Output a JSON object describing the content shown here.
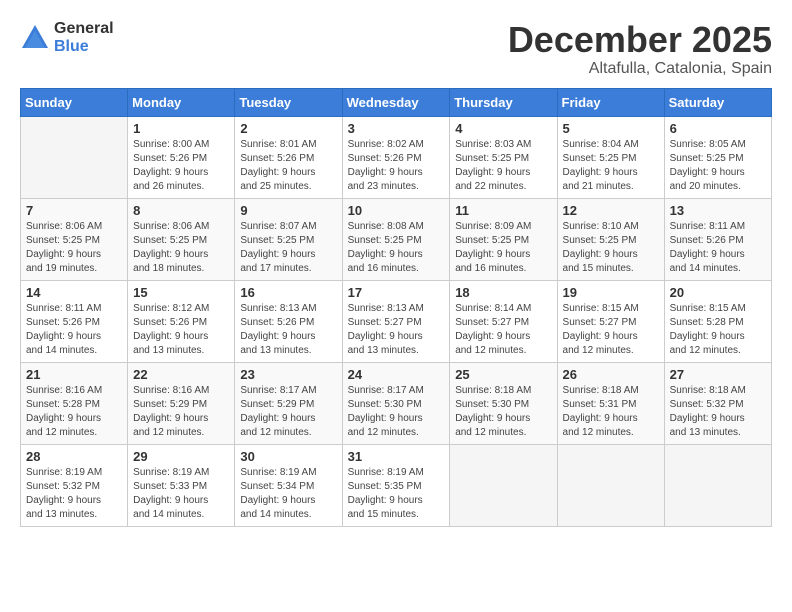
{
  "logo": {
    "general": "General",
    "blue": "Blue"
  },
  "title": {
    "month": "December 2025",
    "location": "Altafulla, Catalonia, Spain"
  },
  "headers": [
    "Sunday",
    "Monday",
    "Tuesday",
    "Wednesday",
    "Thursday",
    "Friday",
    "Saturday"
  ],
  "weeks": [
    [
      {
        "day": "",
        "info": ""
      },
      {
        "day": "1",
        "info": "Sunrise: 8:00 AM\nSunset: 5:26 PM\nDaylight: 9 hours\nand 26 minutes."
      },
      {
        "day": "2",
        "info": "Sunrise: 8:01 AM\nSunset: 5:26 PM\nDaylight: 9 hours\nand 25 minutes."
      },
      {
        "day": "3",
        "info": "Sunrise: 8:02 AM\nSunset: 5:26 PM\nDaylight: 9 hours\nand 23 minutes."
      },
      {
        "day": "4",
        "info": "Sunrise: 8:03 AM\nSunset: 5:25 PM\nDaylight: 9 hours\nand 22 minutes."
      },
      {
        "day": "5",
        "info": "Sunrise: 8:04 AM\nSunset: 5:25 PM\nDaylight: 9 hours\nand 21 minutes."
      },
      {
        "day": "6",
        "info": "Sunrise: 8:05 AM\nSunset: 5:25 PM\nDaylight: 9 hours\nand 20 minutes."
      }
    ],
    [
      {
        "day": "7",
        "info": "Sunrise: 8:06 AM\nSunset: 5:25 PM\nDaylight: 9 hours\nand 19 minutes."
      },
      {
        "day": "8",
        "info": "Sunrise: 8:06 AM\nSunset: 5:25 PM\nDaylight: 9 hours\nand 18 minutes."
      },
      {
        "day": "9",
        "info": "Sunrise: 8:07 AM\nSunset: 5:25 PM\nDaylight: 9 hours\nand 17 minutes."
      },
      {
        "day": "10",
        "info": "Sunrise: 8:08 AM\nSunset: 5:25 PM\nDaylight: 9 hours\nand 16 minutes."
      },
      {
        "day": "11",
        "info": "Sunrise: 8:09 AM\nSunset: 5:25 PM\nDaylight: 9 hours\nand 16 minutes."
      },
      {
        "day": "12",
        "info": "Sunrise: 8:10 AM\nSunset: 5:25 PM\nDaylight: 9 hours\nand 15 minutes."
      },
      {
        "day": "13",
        "info": "Sunrise: 8:11 AM\nSunset: 5:26 PM\nDaylight: 9 hours\nand 14 minutes."
      }
    ],
    [
      {
        "day": "14",
        "info": "Sunrise: 8:11 AM\nSunset: 5:26 PM\nDaylight: 9 hours\nand 14 minutes."
      },
      {
        "day": "15",
        "info": "Sunrise: 8:12 AM\nSunset: 5:26 PM\nDaylight: 9 hours\nand 13 minutes."
      },
      {
        "day": "16",
        "info": "Sunrise: 8:13 AM\nSunset: 5:26 PM\nDaylight: 9 hours\nand 13 minutes."
      },
      {
        "day": "17",
        "info": "Sunrise: 8:13 AM\nSunset: 5:27 PM\nDaylight: 9 hours\nand 13 minutes."
      },
      {
        "day": "18",
        "info": "Sunrise: 8:14 AM\nSunset: 5:27 PM\nDaylight: 9 hours\nand 12 minutes."
      },
      {
        "day": "19",
        "info": "Sunrise: 8:15 AM\nSunset: 5:27 PM\nDaylight: 9 hours\nand 12 minutes."
      },
      {
        "day": "20",
        "info": "Sunrise: 8:15 AM\nSunset: 5:28 PM\nDaylight: 9 hours\nand 12 minutes."
      }
    ],
    [
      {
        "day": "21",
        "info": "Sunrise: 8:16 AM\nSunset: 5:28 PM\nDaylight: 9 hours\nand 12 minutes."
      },
      {
        "day": "22",
        "info": "Sunrise: 8:16 AM\nSunset: 5:29 PM\nDaylight: 9 hours\nand 12 minutes."
      },
      {
        "day": "23",
        "info": "Sunrise: 8:17 AM\nSunset: 5:29 PM\nDaylight: 9 hours\nand 12 minutes."
      },
      {
        "day": "24",
        "info": "Sunrise: 8:17 AM\nSunset: 5:30 PM\nDaylight: 9 hours\nand 12 minutes."
      },
      {
        "day": "25",
        "info": "Sunrise: 8:18 AM\nSunset: 5:30 PM\nDaylight: 9 hours\nand 12 minutes."
      },
      {
        "day": "26",
        "info": "Sunrise: 8:18 AM\nSunset: 5:31 PM\nDaylight: 9 hours\nand 12 minutes."
      },
      {
        "day": "27",
        "info": "Sunrise: 8:18 AM\nSunset: 5:32 PM\nDaylight: 9 hours\nand 13 minutes."
      }
    ],
    [
      {
        "day": "28",
        "info": "Sunrise: 8:19 AM\nSunset: 5:32 PM\nDaylight: 9 hours\nand 13 minutes."
      },
      {
        "day": "29",
        "info": "Sunrise: 8:19 AM\nSunset: 5:33 PM\nDaylight: 9 hours\nand 14 minutes."
      },
      {
        "day": "30",
        "info": "Sunrise: 8:19 AM\nSunset: 5:34 PM\nDaylight: 9 hours\nand 14 minutes."
      },
      {
        "day": "31",
        "info": "Sunrise: 8:19 AM\nSunset: 5:35 PM\nDaylight: 9 hours\nand 15 minutes."
      },
      {
        "day": "",
        "info": ""
      },
      {
        "day": "",
        "info": ""
      },
      {
        "day": "",
        "info": ""
      }
    ]
  ]
}
